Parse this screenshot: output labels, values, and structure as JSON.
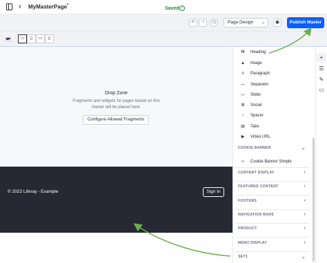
{
  "header": {
    "title": "MyMasterPage",
    "title_mark": "*"
  },
  "controls": {
    "saved_label": "Saved",
    "select_value": "Page Design",
    "publish_label": "Publish Master"
  },
  "canvas": {
    "dropzone_title": "Drop Zone",
    "dropzone_desc": "Fragments and widgets for pages based on this master will be placed here.",
    "configure_label": "Configure Allowed Fragments",
    "footer_text": "© 2022 Liferay - Example",
    "signin_label": "Sign In"
  },
  "fragments": [
    {
      "label": "Heading",
      "icon": "heading-icon"
    },
    {
      "label": "Image",
      "icon": "image-icon"
    },
    {
      "label": "Paragraph",
      "icon": "paragraph-icon"
    },
    {
      "label": "Separator",
      "icon": "separator-icon"
    },
    {
      "label": "Slider",
      "icon": "slider-icon"
    },
    {
      "label": "Social",
      "icon": "social-icon"
    },
    {
      "label": "Spacer",
      "icon": "spacer-icon"
    },
    {
      "label": "Tabs",
      "icon": "tabs-icon"
    },
    {
      "label": "Video URL",
      "icon": "video-icon"
    }
  ],
  "sections": {
    "cookie_banner": "COOKIE BANNER",
    "cookie_item": "Cookie Banner Simple",
    "content_display": "CONTENT DISPLAY",
    "featured_content": "FEATURED CONTENT",
    "footers": "FOOTERS",
    "navigation_bars": "NAVIGATION BARS",
    "product": "PRODUCT",
    "menu_display": "MENU DISPLAY",
    "set1": "SET1"
  },
  "colors": {
    "accent": "#0b5fff",
    "arrow": "#6ab04c",
    "footer_bg": "#272833",
    "saved": "#287d3c"
  }
}
